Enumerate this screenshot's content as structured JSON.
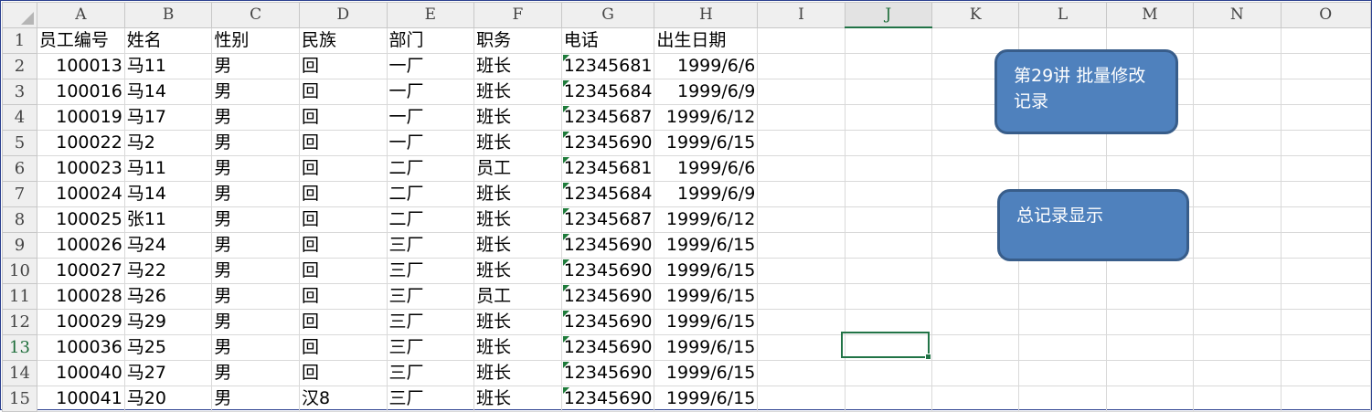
{
  "columns": [
    "A",
    "B",
    "C",
    "D",
    "E",
    "F",
    "G",
    "H",
    "I",
    "J",
    "K",
    "L",
    "M",
    "N",
    "O"
  ],
  "selected_column": "J",
  "selected_row": "13",
  "rows": [
    {
      "n": "1",
      "cells": [
        "员工编号",
        "姓名",
        "性别",
        "民族",
        "部门",
        "职务",
        "电话",
        "出生日期"
      ]
    },
    {
      "n": "2",
      "cells": [
        "100013",
        "马11",
        "男",
        "回",
        "一厂",
        "班长",
        "12345681",
        "1999/6/6"
      ]
    },
    {
      "n": "3",
      "cells": [
        "100016",
        "马14",
        "男",
        "回",
        "一厂",
        "班长",
        "12345684",
        "1999/6/9"
      ]
    },
    {
      "n": "4",
      "cells": [
        "100019",
        "马17",
        "男",
        "回",
        "一厂",
        "班长",
        "12345687",
        "1999/6/12"
      ]
    },
    {
      "n": "5",
      "cells": [
        "100022",
        "马2",
        "男",
        "回",
        "一厂",
        "班长",
        "12345690",
        "1999/6/15"
      ]
    },
    {
      "n": "6",
      "cells": [
        "100023",
        "马11",
        "男",
        "回",
        "二厂",
        "员工",
        "12345681",
        "1999/6/6"
      ]
    },
    {
      "n": "7",
      "cells": [
        "100024",
        "马14",
        "男",
        "回",
        "二厂",
        "班长",
        "12345684",
        "1999/6/9"
      ]
    },
    {
      "n": "8",
      "cells": [
        "100025",
        "张11",
        "男",
        "回",
        "二厂",
        "班长",
        "12345687",
        "1999/6/12"
      ]
    },
    {
      "n": "9",
      "cells": [
        "100026",
        "马24",
        "男",
        "回",
        "三厂",
        "班长",
        "12345690",
        "1999/6/15"
      ]
    },
    {
      "n": "10",
      "cells": [
        "100027",
        "马22",
        "男",
        "回",
        "三厂",
        "班长",
        "12345690",
        "1999/6/15"
      ]
    },
    {
      "n": "11",
      "cells": [
        "100028",
        "马26",
        "男",
        "回",
        "三厂",
        "员工",
        "12345690",
        "1999/6/15"
      ]
    },
    {
      "n": "12",
      "cells": [
        "100029",
        "马29",
        "男",
        "回",
        "三厂",
        "班长",
        "12345690",
        "1999/6/15"
      ]
    },
    {
      "n": "13",
      "cells": [
        "100036",
        "马25",
        "男",
        "回",
        "三厂",
        "班长",
        "12345690",
        "1999/6/15"
      ]
    },
    {
      "n": "14",
      "cells": [
        "100040",
        "马27",
        "男",
        "回",
        "三厂",
        "班长",
        "12345690",
        "1999/6/15"
      ]
    },
    {
      "n": "15",
      "cells": [
        "100041",
        "马20",
        "男",
        "汉8",
        "三厂",
        "班长",
        "12345690",
        "1999/6/15"
      ]
    }
  ],
  "shapes": {
    "lesson_label": "第29讲 批量修改记录",
    "total_label": "总记录显示"
  },
  "colors": {
    "shape_fill": "#4f81bd",
    "shape_border": "#385d8a",
    "selection": "#217346"
  }
}
